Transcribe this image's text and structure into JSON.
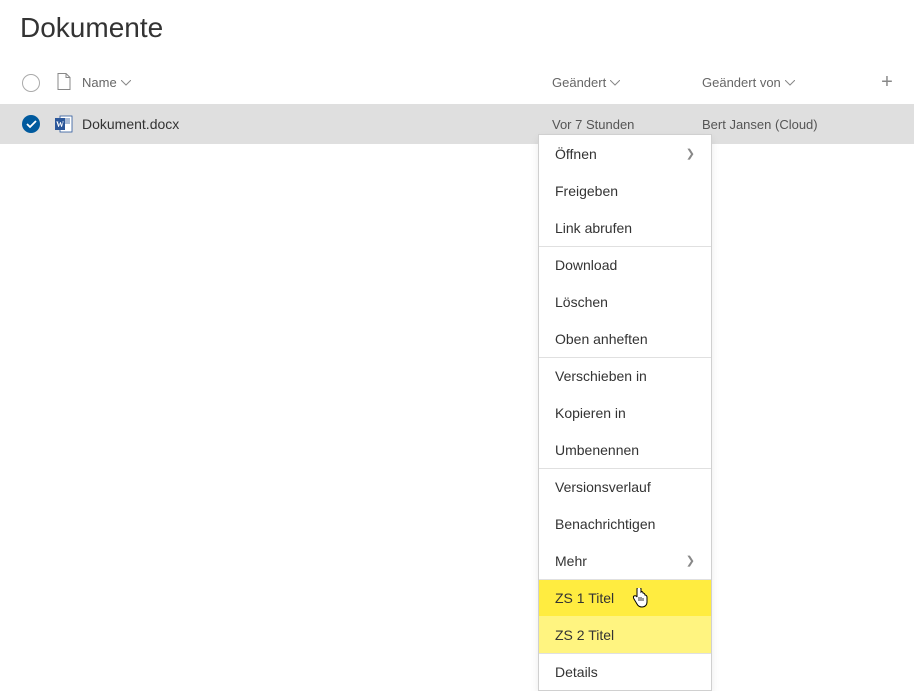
{
  "page": {
    "title": "Dokumente"
  },
  "columns": {
    "name": "Name",
    "modified": "Geändert",
    "modifiedBy": "Geändert von"
  },
  "row": {
    "filename": "Dokument.docx",
    "modified": "Vor 7 Stunden",
    "modifiedBy": "Bert Jansen (Cloud)"
  },
  "menu": {
    "open": "Öffnen",
    "share": "Freigeben",
    "getLink": "Link abrufen",
    "download": "Download",
    "delete": "Löschen",
    "pinTop": "Oben anheften",
    "moveTo": "Verschieben in",
    "copyTo": "Kopieren in",
    "rename": "Umbenennen",
    "versionHistory": "Versionsverlauf",
    "notify": "Benachrichtigen",
    "more": "Mehr",
    "zs1": "ZS 1 Titel",
    "zs2": "ZS 2 Titel",
    "details": "Details"
  }
}
